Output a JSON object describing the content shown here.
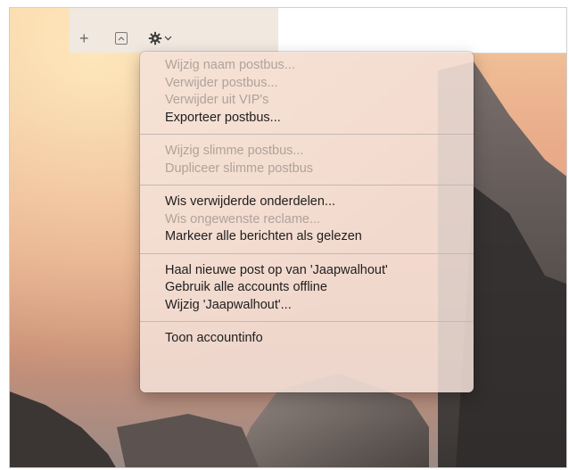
{
  "toolbar": {
    "add_icon": "plus-icon",
    "mailbox_icon": "collapse-box-icon",
    "action_icon": "gear-icon",
    "add_glyph": "+",
    "gear_glyph": "✱"
  },
  "menu": {
    "groups": [
      [
        {
          "label": "Wijzig naam postbus...",
          "enabled": false
        },
        {
          "label": "Verwijder postbus...",
          "enabled": false
        },
        {
          "label": "Verwijder uit VIP's",
          "enabled": false
        },
        {
          "label": "Exporteer postbus...",
          "enabled": true
        }
      ],
      [
        {
          "label": "Wijzig slimme postbus...",
          "enabled": false
        },
        {
          "label": "Dupliceer slimme postbus",
          "enabled": false
        }
      ],
      [
        {
          "label": "Wis verwijderde onderdelen...",
          "enabled": true
        },
        {
          "label": "Wis ongewenste reclame...",
          "enabled": false
        },
        {
          "label": "Markeer alle berichten als gelezen",
          "enabled": true
        }
      ],
      [
        {
          "label": "Haal nieuwe post op van 'Jaapwalhout'",
          "enabled": true
        },
        {
          "label": "Gebruik alle accounts offline",
          "enabled": true
        },
        {
          "label": "Wijzig 'Jaapwalhout'...",
          "enabled": true
        }
      ],
      [
        {
          "label": "Toon accountinfo",
          "enabled": true
        }
      ]
    ]
  },
  "colors": {
    "enabled_text": "#1e1e1e",
    "disabled_text": "#b0a29b",
    "menu_background": "#f4e2da"
  }
}
